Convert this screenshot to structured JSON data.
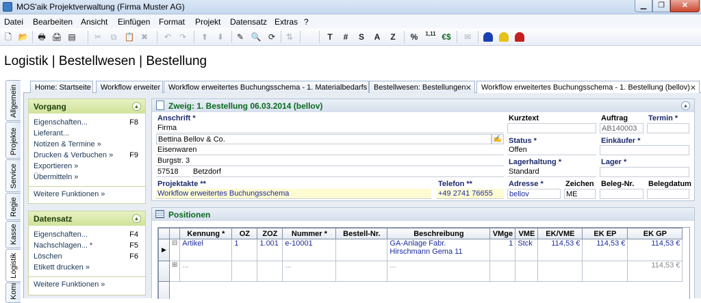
{
  "window": {
    "title": "MOS'aik Projektverwaltung (Firma Muster AG)",
    "min_glyph": "▁",
    "max_glyph": "❐",
    "close_glyph": "✕"
  },
  "menu": [
    "Datei",
    "Bearbeiten",
    "Ansicht",
    "Einfügen",
    "Format",
    "Projekt",
    "Datensatz",
    "Extras",
    "?"
  ],
  "toolbar": {
    "text_buttons": [
      "T",
      "#",
      "S",
      "A",
      "Z",
      "%",
      "1,11",
      "€$"
    ]
  },
  "page_heading": "Logistik | Bestellwesen | Bestellung",
  "left_tabs": [
    "Allgemein",
    "Projekte",
    "Service",
    "Regie",
    "Kasse",
    "Logistik",
    "Kommer"
  ],
  "doc_tabs": [
    {
      "label": "Home: Startseite"
    },
    {
      "label": "Workflow erweiter"
    },
    {
      "label": "Workflow erweitertes Buchungsschema - 1. Materialbedarfs"
    },
    {
      "label": "Bestellwesen: Bestellungen",
      "close": "✕"
    },
    {
      "label": "Workflow erweitertes Buchungsschema - 1. Bestellung (bellov)",
      "close": "✕"
    }
  ],
  "vorgang": {
    "title": "Vorgang",
    "items": [
      {
        "label": "Eigenschaften...",
        "key": "F8"
      },
      {
        "label": "Lieferant...",
        "key": ""
      },
      {
        "label": "Notizen & Termine »",
        "key": ""
      },
      {
        "label": "Drucken & Verbuchen »",
        "key": "F9"
      },
      {
        "label": "Exportieren »",
        "key": ""
      },
      {
        "label": "Übermitteln »",
        "key": ""
      }
    ],
    "more": "Weitere Funktionen »"
  },
  "datensatz": {
    "title": "Datensatz",
    "items": [
      {
        "label": "Eigenschaften...",
        "key": "F4"
      },
      {
        "label": "Nachschlagen... *",
        "key": "F5"
      },
      {
        "label": "Löschen",
        "key": "F6"
      },
      {
        "label": "Etikett drucken »",
        "key": ""
      }
    ],
    "more": "Weitere Funktionen »"
  },
  "form": {
    "title": "Zweig: 1. Bestellung 06.03.2014 (bellov)",
    "anschrift_label": "Anschrift *",
    "anschrift": [
      "Firma",
      "Bettina Bellov & Co.",
      "Eisenwaren",
      "Burgstr. 3"
    ],
    "plz": "57518",
    "ort": "Betzdorf",
    "kurztext_label": "Kurztext",
    "kurztext": "",
    "auftrag_label": "Auftrag",
    "auftrag": "AB140003",
    "termin_label": "Termin *",
    "termin": "",
    "status_label": "Status *",
    "status": "Offen",
    "einkaeufer_label": "Einkäufer *",
    "einkaeufer": "",
    "lagerhaltung_label": "Lagerhaltung *",
    "lagerhaltung": "Standard",
    "lager_label": "Lager *",
    "lager": "",
    "projektakte_label": "Projektakte **",
    "projektakte": "Workflow erweitertes Buchungsschema",
    "telefon_label": "Telefon **",
    "telefon": "+49 2741 76655",
    "adresse_label": "Adresse *",
    "adresse": "bellov",
    "zeichen_label": "Zeichen",
    "zeichen": "ME",
    "belegnr_label": "Beleg-Nr.",
    "belegnr": "",
    "belegdatum_label": "Belegdatum",
    "belegdatum": ""
  },
  "positionen": {
    "title": "Positionen",
    "columns": [
      "Kennung *",
      "OZ",
      "ZOZ",
      "Nummer *",
      "Bestell-Nr.",
      "Beschreibung",
      "VMge",
      "VME",
      "EK/VME",
      "EK EP",
      "EK GP"
    ],
    "rows": [
      {
        "marker": "▶",
        "expand": "⊟",
        "cells": [
          "Artikel",
          "1",
          "1.001",
          "e-10001",
          "",
          "GA-Anlage Fabr. Hirschmann Gema 11",
          "1",
          "Stck",
          "114,53 €",
          "114,53 €",
          "114,53 €"
        ]
      },
      {
        "marker": "",
        "expand": "⊞",
        "cells": [
          "...",
          "",
          "",
          "...",
          "",
          "...",
          "",
          "",
          "",
          "",
          "114,53 €"
        ]
      }
    ]
  }
}
